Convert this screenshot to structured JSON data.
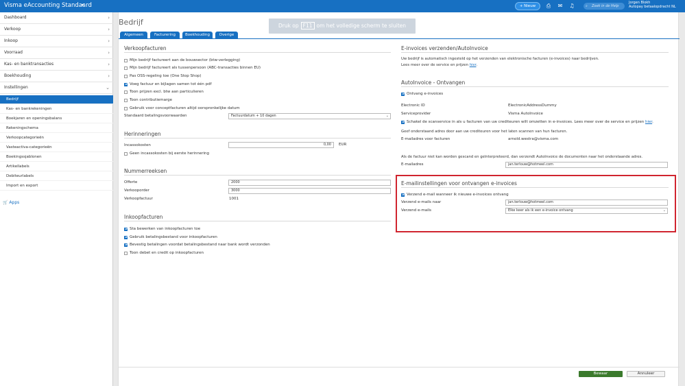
{
  "topbar": {
    "app_title": "Visma eAccounting Standaard",
    "new_button": "+ Nieuw",
    "search_placeholder": "Zoek in de Help",
    "user_name": "Jorgen Blokh",
    "user_company": "Autopay betaalopdracht NL"
  },
  "sidebar": {
    "items": [
      {
        "label": "Dashboard"
      },
      {
        "label": "Verkoop"
      },
      {
        "label": "Inkoop"
      },
      {
        "label": "Voorraad"
      },
      {
        "label": "Kas- en banktransacties"
      },
      {
        "label": "Boekhouding"
      },
      {
        "label": "Instellingen"
      }
    ],
    "subitems": [
      {
        "label": "Bedrijf"
      },
      {
        "label": "Kas- en bankrekeningen"
      },
      {
        "label": "Boekjaren en openingsbalans"
      },
      {
        "label": "Rekeningschema"
      },
      {
        "label": "Verkoopcategorieën"
      },
      {
        "label": "Vasteactiva-categorieën"
      },
      {
        "label": "Boekingssjablonen"
      },
      {
        "label": "Artikellabels"
      },
      {
        "label": "Debiteurlabels"
      },
      {
        "label": "Import en export"
      }
    ],
    "apps_label": "Apps"
  },
  "main": {
    "page_title": "Bedrijf",
    "tabs": [
      {
        "label": "Algemeen"
      },
      {
        "label": "Facturering"
      },
      {
        "label": "Boekhouding"
      },
      {
        "label": "Overige"
      }
    ],
    "banner": {
      "pre": "Druk op",
      "key": "F11",
      "post": "om het volledige scherm te sluiten"
    }
  },
  "verkoopfacturen": {
    "title": "Verkoopfacturen",
    "options": [
      {
        "label": "Mijn bedrijf factureert aan de bouwsector (btw-verlegging)",
        "checked": false
      },
      {
        "label": "Mijn bedrijf factureert als tussenpersoon (ABC-transacties binnen EU)",
        "checked": false
      },
      {
        "label": "Pas OSS-regeling toe (One Stop Shop)",
        "checked": false
      },
      {
        "label": "Voeg factuur en bijlagen samen tot één pdf",
        "checked": true
      },
      {
        "label": "Toon prijzen excl. btw aan particulieren",
        "checked": false
      },
      {
        "label": "Toon contributiemarge",
        "checked": false
      },
      {
        "label": "Gebruik voor conceptfacturen altijd oorspronkelijke datum",
        "checked": false
      }
    ],
    "payment_terms_label": "Standaard betalingsvoorwaarden",
    "payment_terms_value": "Factuurdatum + 10 dagen"
  },
  "herinneringen": {
    "title": "Herinneringen",
    "incasso_label": "Incassokosten",
    "incasso_value": "0,00",
    "currency": "EUR",
    "no_incasso_label": "Geen incassokosten bij eerste herinnering"
  },
  "nummerreeksen": {
    "title": "Nummerreeksen",
    "offerte_label": "Offerte",
    "offerte_value": "2000",
    "verkooporder_label": "Verkooporder",
    "verkooporder_value": "3000",
    "verkoopfactuur_label": "Verkoopfactuur",
    "verkoopfactuur_value": "1001"
  },
  "inkoopfacturen": {
    "title": "Inkoopfacturen",
    "options": [
      {
        "label": "Sta bewerken van inkoopfacturen toe",
        "checked": true
      },
      {
        "label": "Gebruik betalingsbestand voor inkoopfacturen",
        "checked": true
      },
      {
        "label": "Bevestig betalingen voordat betalingsbestand naar bank wordt verzonden",
        "checked": true
      },
      {
        "label": "Toon debet en credit op inkoopfacturen",
        "checked": false
      }
    ]
  },
  "einvoices": {
    "title": "E-invoices verzenden/AutoInvoice",
    "para1": "Uw bedrijf is automatisch ingesteld op het verzenden van elektronische facturen (e-invoices) naar bedrijven.",
    "para2_pre": "Lees meer over de service en prijzen",
    "para2_link": "hier",
    "para2_post": "."
  },
  "autoinvoice": {
    "title": "AutoInvoice - Ontvangen",
    "receive_label": "Ontvang e-invoices",
    "eid_label": "Electronic ID",
    "eid_value": "ElectronicAddressDummy",
    "provider_label": "Serviceprovider",
    "provider_value": "Visma AutoInvoice",
    "scan_label_pre": "Schakel de scanservice in als u facturen van uw crediteuren wilt omzetten in e-invoices. Lees meer over de service en prijzen",
    "scan_link": "hier",
    "scan_post": ".",
    "give_address": "Geef onderstaand adres door aan uw crediteuren voor het laten scannen van hun facturen.",
    "invoice_email_label": "E-mailadres voor facturen",
    "invoice_email_value": "arnold.westra@visma.com",
    "fallback_text": "Als de factuur niet kan worden gescand en geïnterpreteerd, dan verzendt AutoInvoice de documenten naar het onderstaande adres.",
    "email_label": "E-mailadres",
    "email_value": "jan.terlouw@hotmeel.com"
  },
  "emailsettings": {
    "title": "E-mailinstellingen voor ontvangen e-invoices",
    "send_label": "Verzend e-mail wanneer ik nieuwe e-invoices ontvang",
    "send_to_label": "Verzend e-mails naar",
    "send_to_value": "jan.terlouw@hotmeel.com",
    "send_freq_label": "Verzend e-mails",
    "send_freq_value": "Elke keer als ik een e-invoice ontvang"
  },
  "footer": {
    "save_label": "Bewaar",
    "cancel_label": "Annuleer"
  },
  "colors": {
    "accent": "#1770c2",
    "save": "#3b7a2c",
    "highlight": "#d0242e"
  }
}
